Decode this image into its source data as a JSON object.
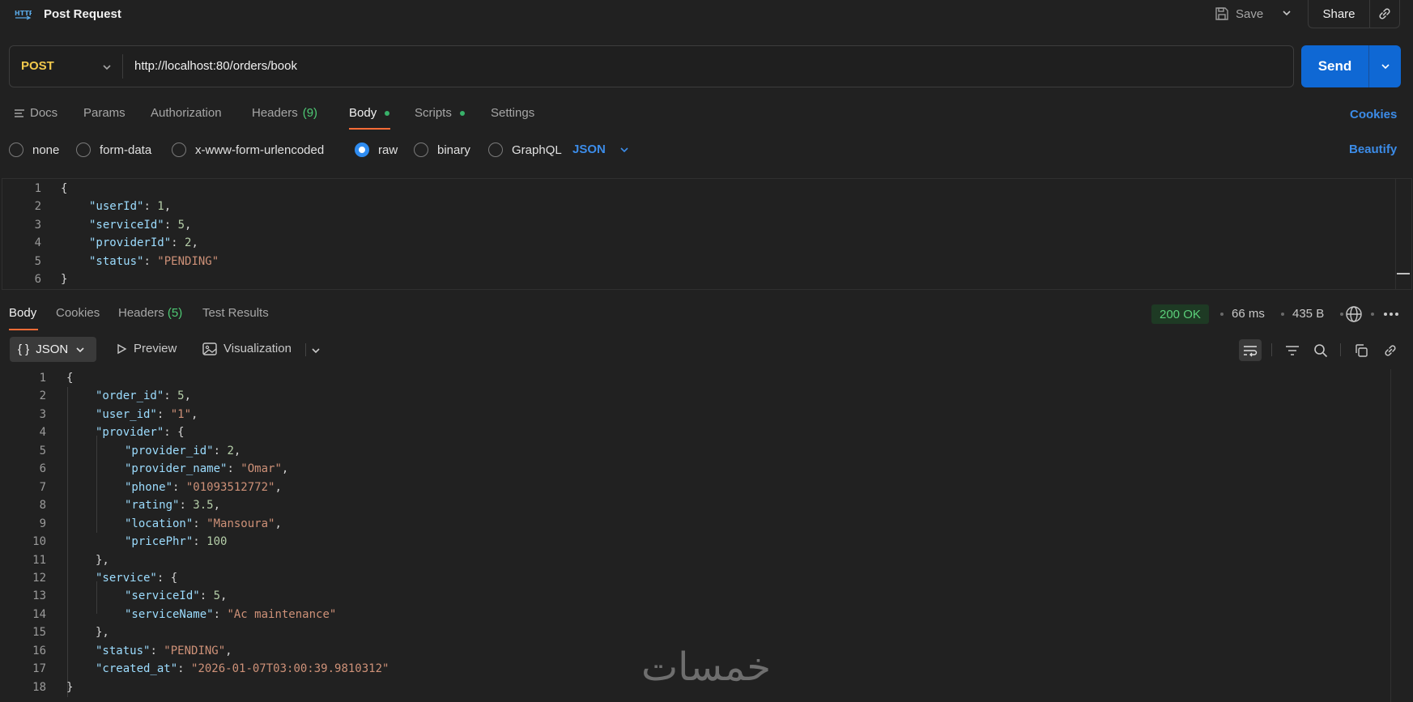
{
  "header": {
    "icon": "http-icon",
    "title": "Post Request",
    "save_label": "Save",
    "share_label": "Share"
  },
  "request": {
    "method": "POST",
    "url": "http://localhost:80/orders/book",
    "send_label": "Send"
  },
  "request_tabs": [
    {
      "label": "Docs"
    },
    {
      "label": "Params"
    },
    {
      "label": "Authorization"
    },
    {
      "label": "Headers",
      "count": "(9)"
    },
    {
      "label": "Body",
      "active": true
    },
    {
      "label": "Scripts"
    },
    {
      "label": "Settings"
    }
  ],
  "cookies_label": "Cookies",
  "body_types": [
    {
      "label": "none",
      "selected": false
    },
    {
      "label": "form-data",
      "selected": false
    },
    {
      "label": "x-www-form-urlencoded",
      "selected": false
    },
    {
      "label": "raw",
      "selected": true
    },
    {
      "label": "binary",
      "selected": false
    },
    {
      "label": "GraphQL",
      "selected": false
    }
  ],
  "body_language": "JSON",
  "beautify_label": "Beautify",
  "request_body": [
    {
      "num": "1",
      "text": "{"
    },
    {
      "num": "2",
      "key": "\"userId\"",
      "val": "1",
      "type": "n",
      "tail": ","
    },
    {
      "num": "3",
      "key": "\"serviceId\"",
      "val": "5",
      "type": "n",
      "tail": ","
    },
    {
      "num": "4",
      "key": "\"providerId\"",
      "val": "2",
      "type": "n",
      "tail": ","
    },
    {
      "num": "5",
      "key": "\"status\"",
      "val": "\"PENDING\"",
      "type": "s",
      "tail": ""
    },
    {
      "num": "6",
      "text": "}"
    }
  ],
  "response_tabs": [
    {
      "label": "Body",
      "active": true
    },
    {
      "label": "Cookies"
    },
    {
      "label": "Headers",
      "count": "(5)"
    },
    {
      "label": "Test Results"
    }
  ],
  "response_meta": {
    "status": "200 OK",
    "time": "66 ms",
    "size": "435 B"
  },
  "response_toolbar": {
    "format_label": "JSON",
    "format_icon": "{ }",
    "preview_label": "Preview",
    "visualization_label": "Visualization"
  },
  "response_body": [
    {
      "num": "1",
      "indent": 0,
      "text": "{"
    },
    {
      "num": "2",
      "indent": 1,
      "key": "\"order_id\"",
      "val": "5",
      "type": "n",
      "tail": ","
    },
    {
      "num": "3",
      "indent": 1,
      "key": "\"user_id\"",
      "val": "\"1\"",
      "type": "s",
      "tail": ","
    },
    {
      "num": "4",
      "indent": 1,
      "key": "\"provider\"",
      "val": "{",
      "type": "p",
      "tail": ""
    },
    {
      "num": "5",
      "indent": 2,
      "key": "\"provider_id\"",
      "val": "2",
      "type": "n",
      "tail": ","
    },
    {
      "num": "6",
      "indent": 2,
      "key": "\"provider_name\"",
      "val": "\"Omar\"",
      "type": "s",
      "tail": ","
    },
    {
      "num": "7",
      "indent": 2,
      "key": "\"phone\"",
      "val": "\"01093512772\"",
      "type": "s",
      "tail": ","
    },
    {
      "num": "8",
      "indent": 2,
      "key": "\"rating\"",
      "val": "3.5",
      "type": "n",
      "tail": ","
    },
    {
      "num": "9",
      "indent": 2,
      "key": "\"location\"",
      "val": "\"Mansoura\"",
      "type": "s",
      "tail": ","
    },
    {
      "num": "10",
      "indent": 2,
      "key": "\"pricePhr\"",
      "val": "100",
      "type": "n",
      "tail": ""
    },
    {
      "num": "11",
      "indent": 1,
      "text": "},"
    },
    {
      "num": "12",
      "indent": 1,
      "key": "\"service\"",
      "val": "{",
      "type": "p",
      "tail": ""
    },
    {
      "num": "13",
      "indent": 2,
      "key": "\"serviceId\"",
      "val": "5",
      "type": "n",
      "tail": ","
    },
    {
      "num": "14",
      "indent": 2,
      "key": "\"serviceName\"",
      "val": "\"Ac maintenance\"",
      "type": "s",
      "tail": ""
    },
    {
      "num": "15",
      "indent": 1,
      "text": "},"
    },
    {
      "num": "16",
      "indent": 1,
      "key": "\"status\"",
      "val": "\"PENDING\"",
      "type": "s",
      "tail": ","
    },
    {
      "num": "17",
      "indent": 1,
      "key": "\"created_at\"",
      "val": "\"2026-01-07T03:00:39.9810312\"",
      "type": "s",
      "tail": ""
    },
    {
      "num": "18",
      "indent": 0,
      "text": "}"
    }
  ],
  "watermark": "خمسات",
  "colors": {
    "accent": "#ff6c37",
    "primary": "#0f68d4",
    "link": "#3c8ce8",
    "method": "#f2c94c",
    "success": "#5bd07a"
  }
}
